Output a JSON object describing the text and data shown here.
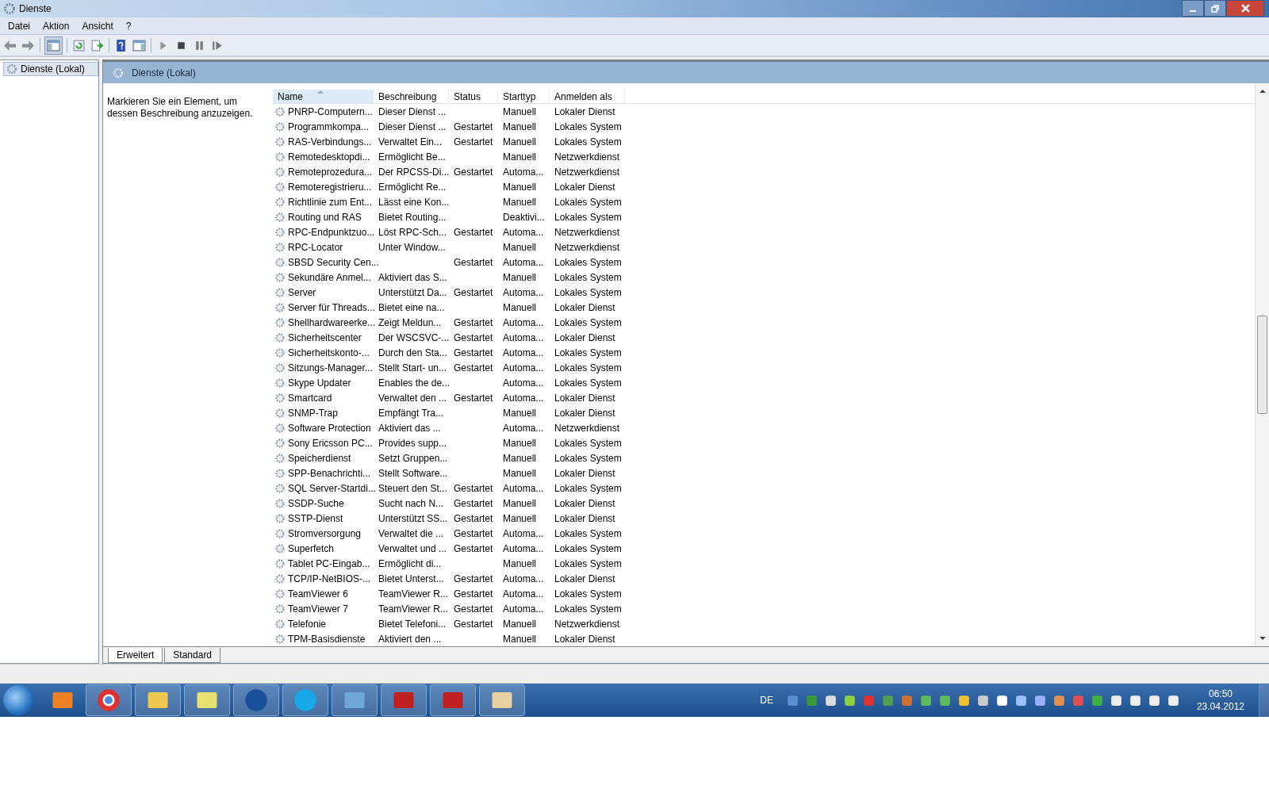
{
  "window": {
    "title": "Dienste"
  },
  "menu": [
    "Datei",
    "Aktion",
    "Ansicht",
    "?"
  ],
  "tree": {
    "items": [
      {
        "label": "Dienste (Lokal)",
        "selected": true
      }
    ]
  },
  "panel": {
    "title": "Dienste (Lokal)",
    "hint": "Markieren Sie ein Element, um dessen Beschreibung anzuzeigen."
  },
  "table": {
    "columns": [
      "Name",
      "Beschreibung",
      "Status",
      "Starttyp",
      "Anmelden als"
    ],
    "rows": [
      [
        "PNRP-Computern...",
        "Dieser Dienst ...",
        "",
        "Manuell",
        "Lokaler Dienst"
      ],
      [
        "Programmkompa...",
        "Dieser Dienst ...",
        "Gestartet",
        "Manuell",
        "Lokales System"
      ],
      [
        "RAS-Verbindungs...",
        "Verwaltet Ein...",
        "Gestartet",
        "Manuell",
        "Lokales System"
      ],
      [
        "Remotedesktopdi...",
        "Ermöglicht Be...",
        "",
        "Manuell",
        "Netzwerkdienst"
      ],
      [
        "Remoteprozedura...",
        "Der RPCSS-Di...",
        "Gestartet",
        "Automa...",
        "Netzwerkdienst"
      ],
      [
        "Remoteregistrieru...",
        "Ermöglicht Re...",
        "",
        "Manuell",
        "Lokaler Dienst"
      ],
      [
        "Richtlinie zum Ent...",
        "Lässt eine Kon...",
        "",
        "Manuell",
        "Lokales System"
      ],
      [
        "Routing und RAS",
        "Bietet Routing...",
        "",
        "Deaktivi...",
        "Lokales System"
      ],
      [
        "RPC-Endpunktzuo...",
        "Löst RPC-Sch...",
        "Gestartet",
        "Automa...",
        "Netzwerkdienst"
      ],
      [
        "RPC-Locator",
        "Unter Window...",
        "",
        "Manuell",
        "Netzwerkdienst"
      ],
      [
        "SBSD Security Cen...",
        "",
        "Gestartet",
        "Automa...",
        "Lokales System"
      ],
      [
        "Sekundäre Anmel...",
        "Aktiviert das S...",
        "",
        "Manuell",
        "Lokales System"
      ],
      [
        "Server",
        "Unterstützt Da...",
        "Gestartet",
        "Automa...",
        "Lokales System"
      ],
      [
        "Server für Threads...",
        "Bietet eine na...",
        "",
        "Manuell",
        "Lokaler Dienst"
      ],
      [
        "Shellhardwareerke...",
        "Zeigt Meldun...",
        "Gestartet",
        "Automa...",
        "Lokales System"
      ],
      [
        "Sicherheitscenter",
        "Der WSCSVC-...",
        "Gestartet",
        "Automa...",
        "Lokaler Dienst"
      ],
      [
        "Sicherheitskonto-...",
        "Durch den Sta...",
        "Gestartet",
        "Automa...",
        "Lokales System"
      ],
      [
        "Sitzungs-Manager...",
        "Stellt Start- un...",
        "Gestartet",
        "Automa...",
        "Lokales System"
      ],
      [
        "Skype Updater",
        "Enables the de...",
        "",
        "Automa...",
        "Lokales System"
      ],
      [
        "Smartcard",
        "Verwaltet den ...",
        "Gestartet",
        "Automa...",
        "Lokaler Dienst"
      ],
      [
        "SNMP-Trap",
        "Empfängt Tra...",
        "",
        "Manuell",
        "Lokaler Dienst"
      ],
      [
        "Software Protection",
        "Aktiviert das ...",
        "",
        "Automa...",
        "Netzwerkdienst"
      ],
      [
        "Sony Ericsson PC...",
        "Provides supp...",
        "",
        "Manuell",
        "Lokales System"
      ],
      [
        "Speicherdienst",
        "Setzt Gruppen...",
        "",
        "Manuell",
        "Lokales System"
      ],
      [
        "SPP-Benachrichti...",
        "Stellt Software...",
        "",
        "Manuell",
        "Lokaler Dienst"
      ],
      [
        "SQL Server-Startdi...",
        "Steuert den St...",
        "Gestartet",
        "Automa...",
        "Lokales System"
      ],
      [
        "SSDP-Suche",
        "Sucht nach N...",
        "Gestartet",
        "Manuell",
        "Lokaler Dienst"
      ],
      [
        "SSTP-Dienst",
        "Unterstützt SS...",
        "Gestartet",
        "Manuell",
        "Lokaler Dienst"
      ],
      [
        "Stromversorgung",
        "Verwaltet die ...",
        "Gestartet",
        "Automa...",
        "Lokales System"
      ],
      [
        "Superfetch",
        "Verwaltet und ...",
        "Gestartet",
        "Automa...",
        "Lokales System"
      ],
      [
        "Tablet PC-Eingab...",
        "Ermöglicht di...",
        "",
        "Manuell",
        "Lokales System"
      ],
      [
        "TCP/IP-NetBIOS-...",
        "Bietet Unterst...",
        "Gestartet",
        "Automa...",
        "Lokaler Dienst"
      ],
      [
        "TeamViewer 6",
        "TeamViewer R...",
        "Gestartet",
        "Automa...",
        "Lokales System"
      ],
      [
        "TeamViewer 7",
        "TeamViewer R...",
        "Gestartet",
        "Automa...",
        "Lokales System"
      ],
      [
        "Telefonie",
        "Bietet Telefoni...",
        "Gestartet",
        "Manuell",
        "Netzwerkdienst"
      ],
      [
        "TPM-Basisdienste",
        "Aktiviert den ...",
        "",
        "Manuell",
        "Lokaler Dienst"
      ]
    ]
  },
  "view_tabs": [
    {
      "label": "Erweitert",
      "selected": true
    },
    {
      "label": "Standard",
      "selected": false
    }
  ],
  "taskbar": {
    "language": "DE",
    "time": "06:50",
    "date": "23.04.2012"
  }
}
